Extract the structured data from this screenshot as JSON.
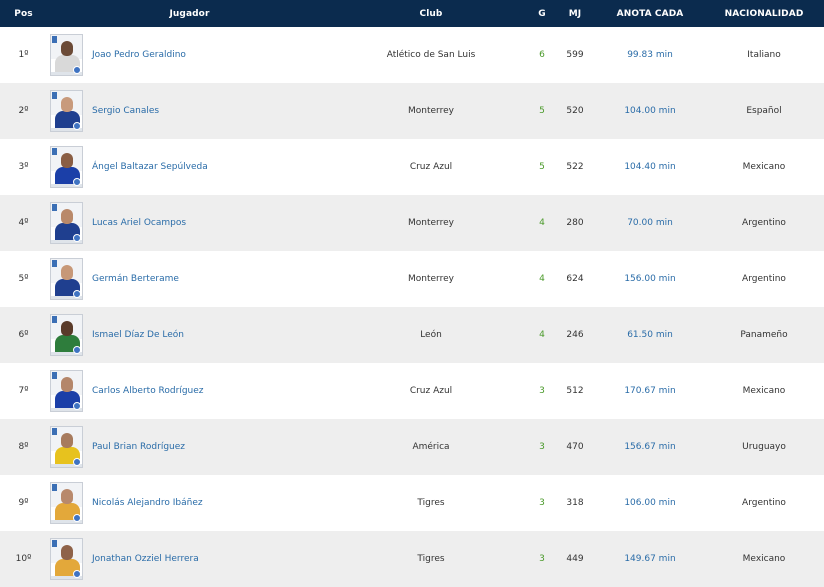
{
  "header": {
    "pos": "Pos",
    "player": "Jugador",
    "club": "Club",
    "goals": "G",
    "matches": "MJ",
    "rate": "ANOTA CADA",
    "nationality": "NACIONALIDAD"
  },
  "rows": [
    {
      "pos": "1º",
      "name": "Joao Pedro Geraldino",
      "club": "Atlético de San Luis",
      "g": "6",
      "mj": "599",
      "rate": "99.83 min",
      "nat": "Italiano",
      "kit": "#d9d9d9",
      "skin": "#6b4a36"
    },
    {
      "pos": "2º",
      "name": "Sergio Canales",
      "club": "Monterrey",
      "g": "5",
      "mj": "520",
      "rate": "104.00 min",
      "nat": "Español",
      "kit": "#1f3f8f",
      "skin": "#c89a7c"
    },
    {
      "pos": "3º",
      "name": "Ángel Baltazar Sepúlveda",
      "club": "Cruz Azul",
      "g": "5",
      "mj": "522",
      "rate": "104.40 min",
      "nat": "Mexicano",
      "kit": "#1b3fa8",
      "skin": "#8a5e44"
    },
    {
      "pos": "4º",
      "name": "Lucas Ariel Ocampos",
      "club": "Monterrey",
      "g": "4",
      "mj": "280",
      "rate": "70.00 min",
      "nat": "Argentino",
      "kit": "#1f3f8f",
      "skin": "#b9896a"
    },
    {
      "pos": "5º",
      "name": "Germán Berterame",
      "club": "Monterrey",
      "g": "4",
      "mj": "624",
      "rate": "156.00 min",
      "nat": "Argentino",
      "kit": "#1f3f8f",
      "skin": "#c79878"
    },
    {
      "pos": "6º",
      "name": "Ismael Díaz De León",
      "club": "León",
      "g": "4",
      "mj": "246",
      "rate": "61.50 min",
      "nat": "Panameño",
      "kit": "#2e7d3c",
      "skin": "#5a3b2a"
    },
    {
      "pos": "7º",
      "name": "Carlos Alberto Rodríguez",
      "club": "Cruz Azul",
      "g": "3",
      "mj": "512",
      "rate": "170.67 min",
      "nat": "Mexicano",
      "kit": "#1b3fa8",
      "skin": "#b4866a"
    },
    {
      "pos": "8º",
      "name": "Paul Brian Rodríguez",
      "club": "América",
      "g": "3",
      "mj": "470",
      "rate": "156.67 min",
      "nat": "Uruguayo",
      "kit": "#e7c21e",
      "skin": "#a77b5e"
    },
    {
      "pos": "9º",
      "name": "Nicolás Alejandro Ibáñez",
      "club": "Tigres",
      "g": "3",
      "mj": "318",
      "rate": "106.00 min",
      "nat": "Argentino",
      "kit": "#e3a83a",
      "skin": "#b8896c"
    },
    {
      "pos": "10º",
      "name": "Jonathan Ozziel Herrera",
      "club": "Tigres",
      "g": "3",
      "mj": "449",
      "rate": "149.67 min",
      "nat": "Mexicano",
      "kit": "#e3a83a",
      "skin": "#8e6249"
    }
  ]
}
